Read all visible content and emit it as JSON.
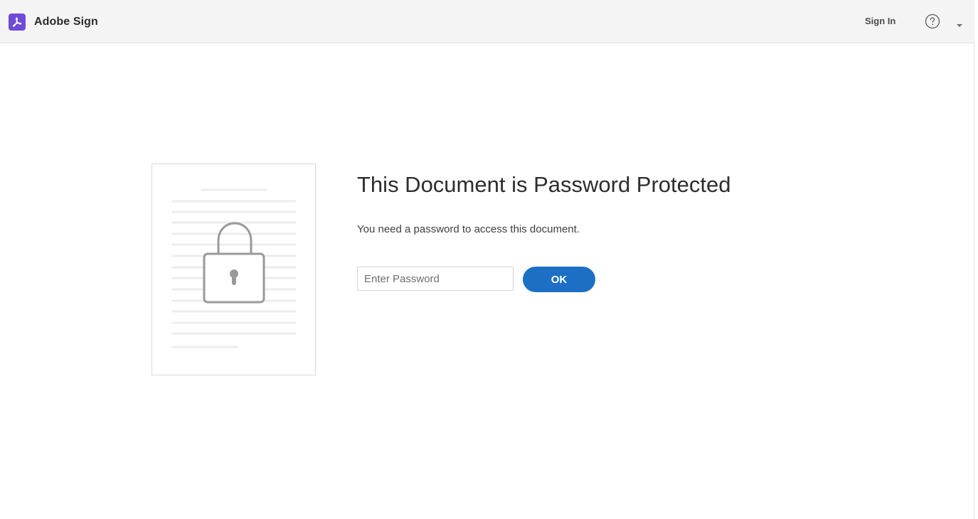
{
  "header": {
    "brand_name": "Adobe Sign",
    "sign_in_label": "Sign In",
    "brand_color": "#6f4bd8",
    "icons": {
      "brand": "adobe-sign-logo-icon",
      "help": "help-circle-icon",
      "menu": "chevron-down-icon"
    }
  },
  "main": {
    "illustration": "locked-document-icon",
    "title": "This Document is Password Protected",
    "message": "You need a password to access this document.",
    "password_field": {
      "placeholder": "Enter Password",
      "value": ""
    },
    "ok_label": "OK",
    "accent_color": "#1c6fc4"
  }
}
